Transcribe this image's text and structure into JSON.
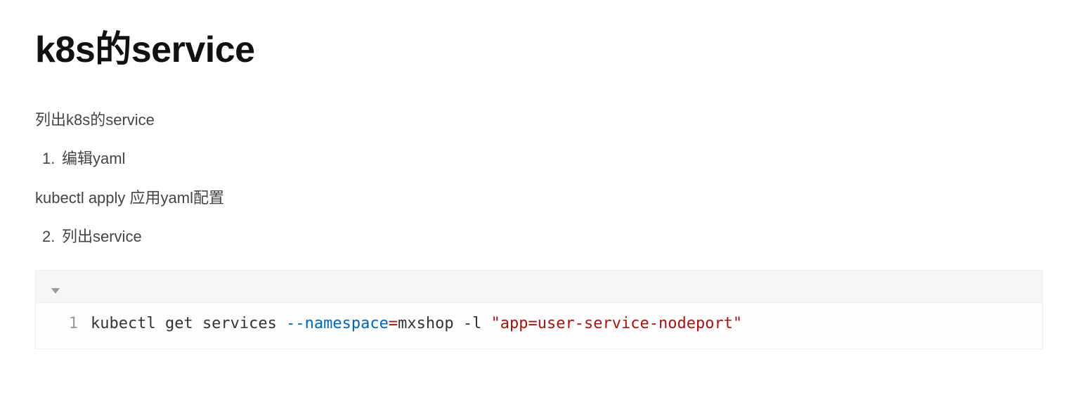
{
  "heading": "k8s的service",
  "intro": "列出k8s的service",
  "item1_marker": "1.",
  "item1_text": "编辑yaml",
  "apply_line": "kubectl apply 应用yaml配置",
  "item2_marker": "2.",
  "item2_text": "列出service",
  "code": {
    "line_no": "1",
    "seg1": "kubectl get services ",
    "seg2": "--namespace",
    "seg3": "=",
    "seg4": "mxshop -l ",
    "seg5": "\"app=user-service-nodeport\""
  }
}
